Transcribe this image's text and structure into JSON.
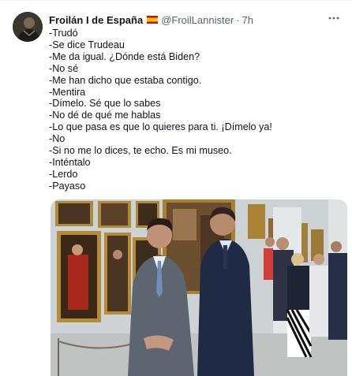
{
  "tweet": {
    "display_name": "Froilán I de España",
    "flag_icon": "spain-flag",
    "handle": "@FroilLannister",
    "separator": "·",
    "time": "7h",
    "more_icon": "more-horizontal-icon",
    "lines": [
      "-Trudó",
      "-Se dice Trudeau",
      "-Me da igual. ¿Dónde está Biden?",
      "-No sé",
      "-Me han dicho que estaba contigo.",
      "-Mentira",
      "-Dímelo. Sé que lo sabes",
      "-No dé de qué me hablas",
      "-Lo que pasa es que lo quieres para ti. ¡Dímelo ya!",
      "-No",
      "-Si no me lo dices, te echo. Es mi museo.",
      "-Inténtalo",
      "-Lerdo",
      "-Payaso"
    ]
  },
  "colors": {
    "text": "#0f1419",
    "secondary": "#536471",
    "wall": "#cfd5d6"
  }
}
